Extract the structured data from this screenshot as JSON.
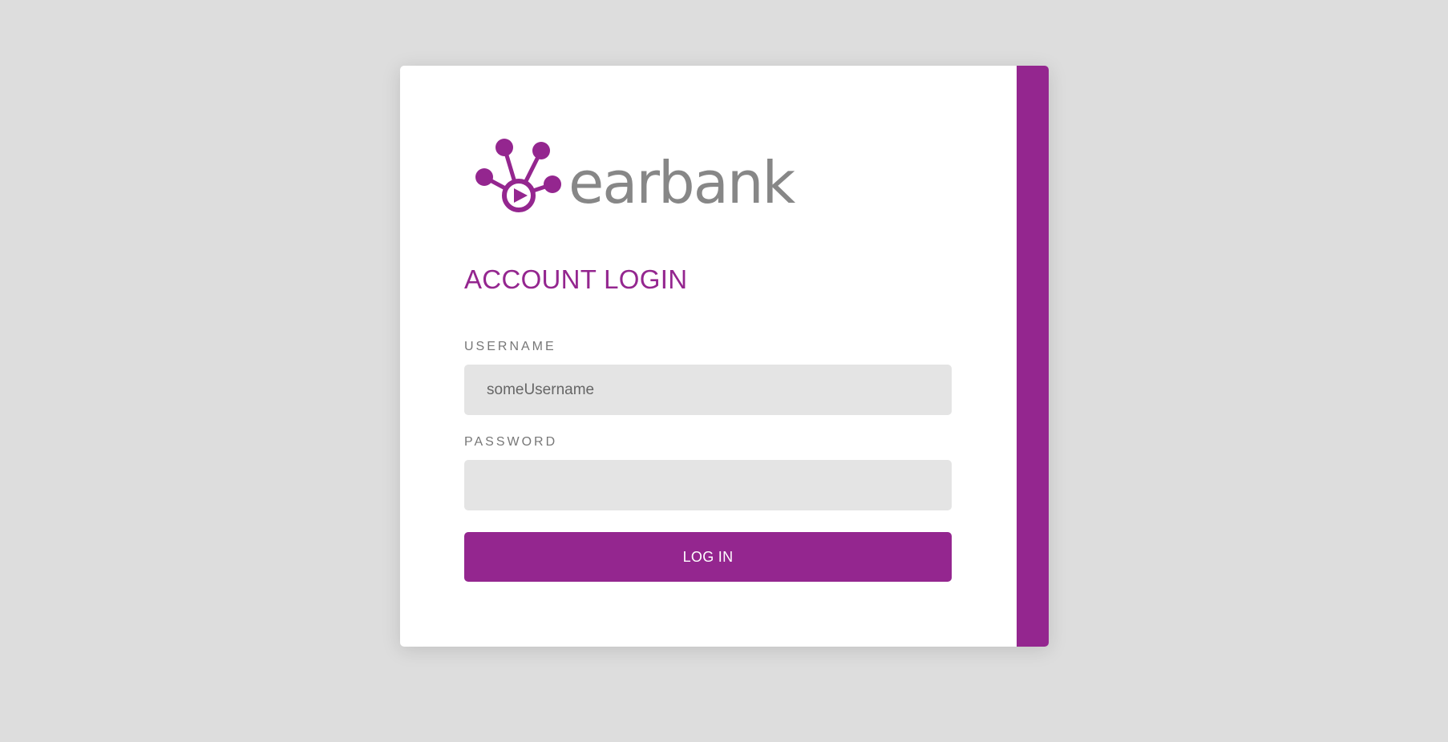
{
  "brand": {
    "name": "earbank",
    "logo_icon": "earbank-node-play-icon",
    "accent_color": "#94268f",
    "wordmark_color": "#878787"
  },
  "login": {
    "title": "ACCOUNT LOGIN",
    "username_label": "USERNAME",
    "username_value": "someUsername",
    "password_label": "PASSWORD",
    "password_value": "",
    "submit_label": "LOG IN"
  }
}
